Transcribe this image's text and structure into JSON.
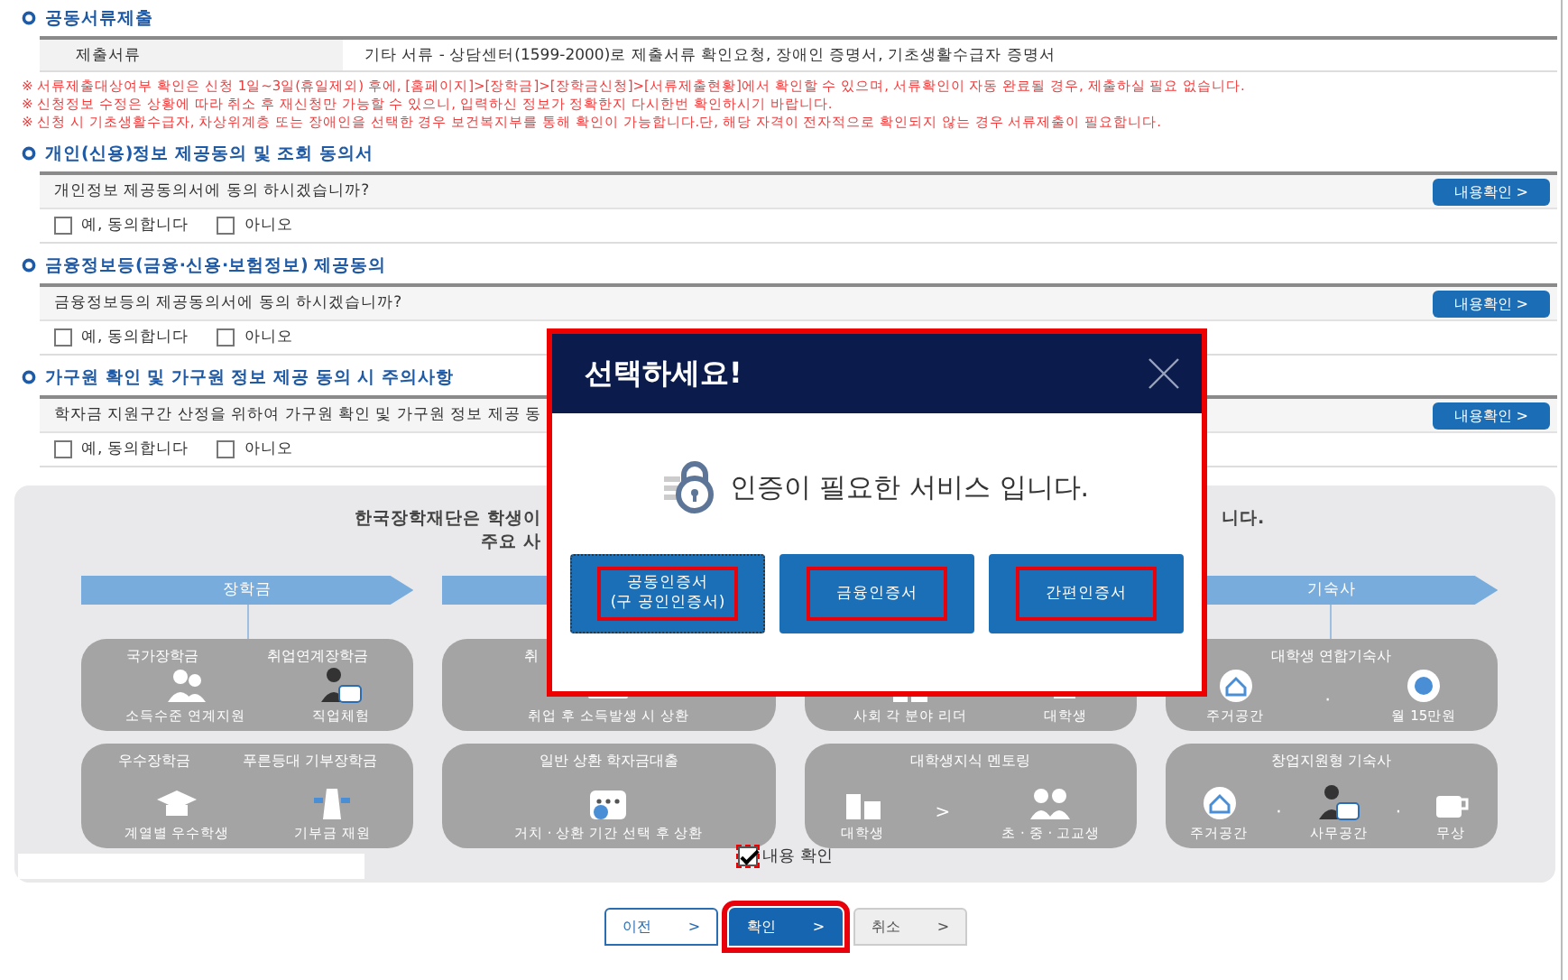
{
  "sections": [
    {
      "kind": "table",
      "title": "공동서류제출",
      "rows": [
        {
          "label": "제출서류",
          "value": "기타 서류 - 상담센터(1599-2000)로 제출서류 확인요청, 장애인 증명서, 기초생활수급자 증명서"
        }
      ],
      "notes": [
        "※ 서류제출대상여부 확인은 신청 1일~3일(휴일제외) 후에, [홈페이지]>[장학금]>[장학금신청]>[서류제출현황]에서 확인할 수 있으며, 서류확인이 자동 완료될 경우, 제출하실 필요 없습니다.",
        "※ 신청정보 수정은 상황에 따라 취소 후 재신청만 가능할 수 있으니, 입력하신 정보가 정확한지 다시한번 확인하시기 바랍니다.",
        "※ 신청 시 기초생활수급자, 차상위계층 또는 장애인을 선택한 경우 보건복지부를 통해 확인이 가능합니다.단, 해당 자격이 전자적으로 확인되지 않는 경우 서류제출이 필요합니다."
      ]
    },
    {
      "kind": "consent",
      "title": "개인(신용)정보 제공동의 및 조회 동의서",
      "question": "개인정보 제공동의서에 동의 하시겠습니까?",
      "button": "내용확인 >",
      "options": [
        {
          "label": "예, 동의합니다",
          "checked": false
        },
        {
          "label": "아니오",
          "checked": false
        }
      ]
    },
    {
      "kind": "consent",
      "title": "금융정보등(금융·신용·보험정보) 제공동의",
      "question": "금융정보등의 제공동의서에 동의 하시겠습니까?",
      "button": "내용확인 >",
      "options": [
        {
          "label": "예, 동의합니다",
          "checked": false
        },
        {
          "label": "아니오",
          "checked": false
        }
      ]
    },
    {
      "kind": "consent",
      "title": "가구원 확인 및 가구원 정보 제공 동의 시 주의사항",
      "question": "학자금 지원구간 산정을 위하여 가구원 확인 및 가구원 정보 제공 동",
      "button": "내용확인 >",
      "options": [
        {
          "label": "예, 동의합니다",
          "checked": false
        },
        {
          "label": "아니오",
          "checked": false
        }
      ]
    }
  ],
  "panel": {
    "intro_lines": [
      "한국장학재단은 학생이",
      "주요 사"
    ],
    "intro_tail": "니다.",
    "columns": [
      {
        "header": "장학금",
        "cards": [
          {
            "titles": [
              "국가장학금",
              "취업연계장학금"
            ],
            "items": [
              {
                "label": "소득수준 연계지원"
              },
              {
                "label": "직업체험"
              }
            ]
          },
          {
            "titles": [
              "우수장학금",
              "푸른등대 기부장학금"
            ],
            "items": [
              {
                "label": "계열별 우수학생"
              },
              {
                "label": "기부금 재원"
              }
            ]
          }
        ]
      },
      {
        "cards": [
          {
            "titles": [
              "취"
            ],
            "items": [
              {
                "label": "취업 후 소득발생 시 상환"
              }
            ]
          },
          {
            "titles": [
              "일반 상환 학자금대출"
            ],
            "items": [
              {
                "label": "거치 · 상환 기간 선택 후 상환"
              }
            ]
          }
        ]
      },
      {
        "cards": [
          {
            "items": [
              {
                "label": "사회 각 분야 리더"
              },
              {
                "label": "대학생"
              }
            ]
          },
          {
            "titles": [
              "대학생지식 멘토링"
            ],
            "separator": ">",
            "items": [
              {
                "label": "대학생"
              },
              {
                "label": "초 · 중 · 고교생"
              }
            ]
          }
        ]
      },
      {
        "header": "기숙사",
        "cards": [
          {
            "titles": [
              "대학생 연합기숙사"
            ],
            "separator": "·",
            "items": [
              {
                "label": "주거공간"
              },
              {
                "label": "월 15만원"
              }
            ]
          },
          {
            "titles": [
              "창업지원형 기숙사"
            ],
            "separator": "·",
            "items": [
              {
                "label": "주거공간"
              },
              {
                "label": "사무공간"
              },
              {
                "label": "무상"
              }
            ]
          }
        ]
      }
    ],
    "confirm": {
      "label": "내용 확인",
      "checked": true,
      "highlighted": true
    }
  },
  "footer": {
    "buttons": [
      {
        "label": "이전 >",
        "kind": "outline",
        "highlighted": false
      },
      {
        "label": "확인 >",
        "kind": "primary",
        "highlighted": true
      },
      {
        "label": "취소 >",
        "kind": "gray",
        "highlighted": false
      }
    ]
  },
  "modal": {
    "title": "선택하세요!",
    "message": "인증이 필요한 서비스 입니다.",
    "highlighted": true,
    "buttons": [
      {
        "lines": [
          "공동인증서",
          "(구 공인인증서)"
        ],
        "highlighted": true,
        "focused": true
      },
      {
        "lines": [
          "금융인증서"
        ],
        "highlighted": true,
        "focused": false
      },
      {
        "lines": [
          "간편인증서"
        ],
        "highlighted": true,
        "focused": false
      }
    ]
  }
}
